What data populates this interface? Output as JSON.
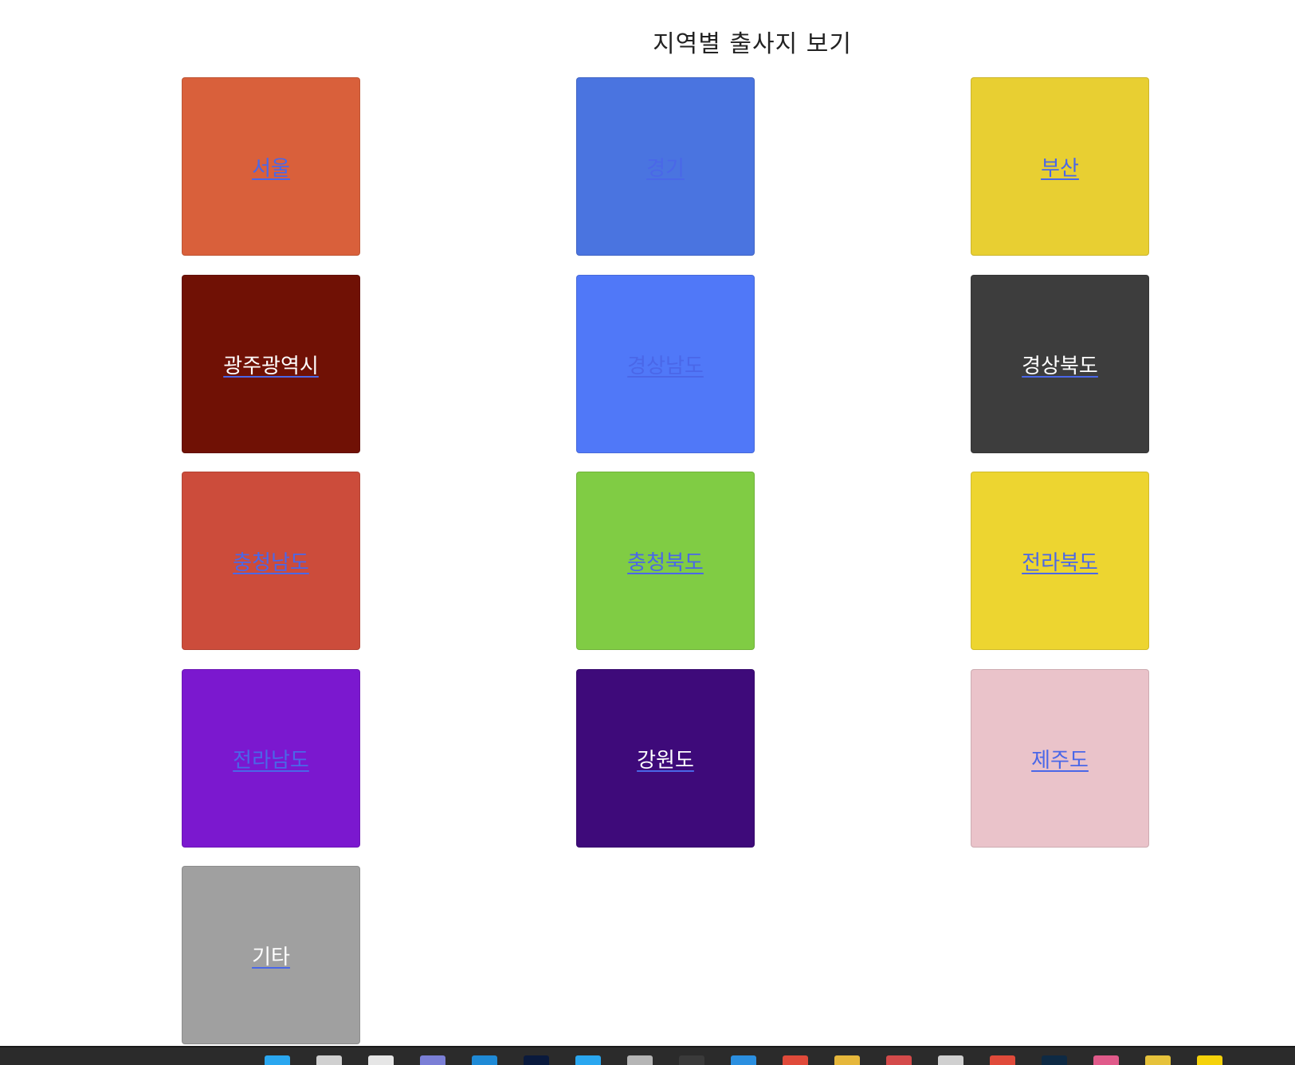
{
  "page": {
    "title": "지역별 출사지 보기"
  },
  "regions": [
    {
      "label": "서울",
      "bg": "#d9603b",
      "text_color": "#4a67e8"
    },
    {
      "label": "경기",
      "bg": "#4a74e0",
      "text_color": "#4a67e8"
    },
    {
      "label": "부산",
      "bg": "#e8cf32",
      "text_color": "#4a67e8"
    },
    {
      "label": "광주광역시",
      "bg": "#701105",
      "text_color": "#ffffff"
    },
    {
      "label": "경상남도",
      "bg": "#5078f8",
      "text_color": "#4a67e8"
    },
    {
      "label": "경상북도",
      "bg": "#3d3d3d",
      "text_color": "#ffffff"
    },
    {
      "label": "충청남도",
      "bg": "#cc4c3b",
      "text_color": "#4a67e8"
    },
    {
      "label": "충청북도",
      "bg": "#80cc44",
      "text_color": "#4a67e8"
    },
    {
      "label": "전라북도",
      "bg": "#edd530",
      "text_color": "#4a67e8"
    },
    {
      "label": "전라남도",
      "bg": "#7b18cf",
      "text_color": "#4a67e8"
    },
    {
      "label": "강원도",
      "bg": "#3e0a7a",
      "text_color": "#ffffff"
    },
    {
      "label": "제주도",
      "bg": "#eac3ca",
      "text_color": "#4a67e8"
    },
    {
      "label": "기타",
      "bg": "#a0a0a0",
      "text_color": "#ffffff"
    }
  ],
  "taskbar": {
    "icons": [
      {
        "name": "windows-start-icon",
        "color": "#2aa7f0"
      },
      {
        "name": "search-icon",
        "color": "#d0d0d0"
      },
      {
        "name": "task-view-icon",
        "color": "#e6e6e6"
      },
      {
        "name": "chat-icon",
        "color": "#7b7fd6"
      },
      {
        "name": "edge-icon",
        "color": "#1f8ad6"
      },
      {
        "name": "photoshop-icon",
        "color": "#0a1a3d"
      },
      {
        "name": "store-icon",
        "color": "#2aa7f0"
      },
      {
        "name": "notepad-icon",
        "color": "#b5b5b5"
      },
      {
        "name": "app-icon",
        "color": "#3a3a3a"
      },
      {
        "name": "vscode-icon",
        "color": "#2b8fe0"
      },
      {
        "name": "chrome-icon",
        "color": "#e04a3a"
      },
      {
        "name": "file-explorer-icon",
        "color": "#e6b73b"
      },
      {
        "name": "calendar-icon",
        "color": "#d44a4a"
      },
      {
        "name": "clock-icon",
        "color": "#d0d0d0"
      },
      {
        "name": "pokeball-icon",
        "color": "#e04a3a"
      },
      {
        "name": "terminal-icon",
        "color": "#0e2a44"
      },
      {
        "name": "brush-icon",
        "color": "#e05a8a"
      },
      {
        "name": "yellow-app-icon",
        "color": "#e6c23b"
      },
      {
        "name": "kakaotalk-icon",
        "color": "#f5d20a"
      }
    ]
  }
}
